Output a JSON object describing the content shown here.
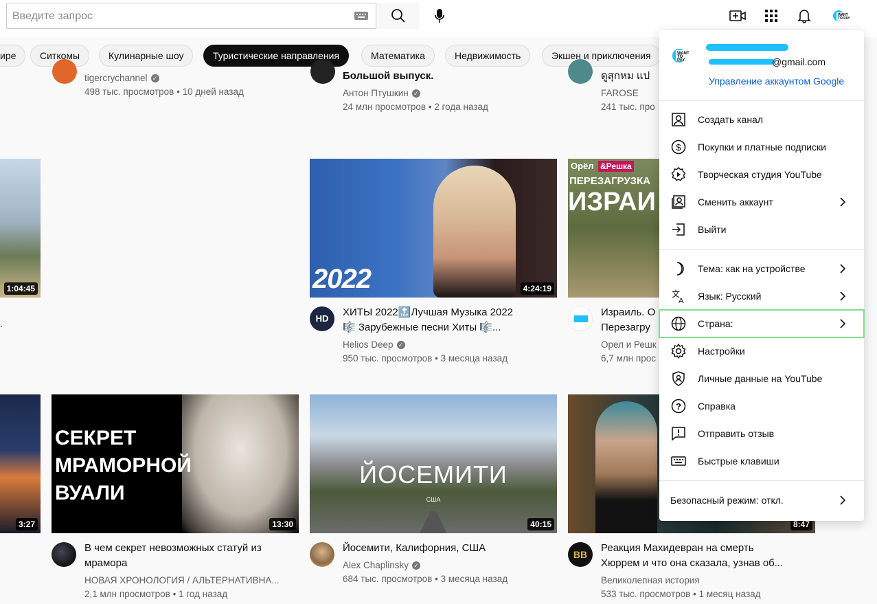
{
  "search": {
    "placeholder": "Введите запрос"
  },
  "chips": [
    "ире",
    "Ситкомы",
    "Кулинарные шоу",
    "Туристические направления",
    "Математика",
    "Недвижимость",
    "Экшен и приключения"
  ],
  "videos_top": [
    {
      "channel": "tigercrychannel",
      "meta": "498 тыс. просмотров • 10 дней назад"
    },
    {
      "title": "Большой выпуск.",
      "channel": "Антон Птушкин",
      "meta": "24 млн просмотров • 2 года назад"
    },
    {
      "title": "ดูสุกหม แป",
      "channel": "FAROSE",
      "meta": "241 тыс. про"
    }
  ],
  "videos_mid": [
    {
      "duration": "1:04:45"
    },
    {
      "duration": "4:24:19",
      "thumb_text": "2022",
      "title_line1": "ХИТЫ 2022🔝Лучшая Музыка 2022",
      "title_line2": "🎼 Зарубежные песни Хиты 🎼...",
      "channel": "Helios Deep",
      "meta": "950 тыс. просмотров • 3 месяца назад",
      "avatar": "HD"
    },
    {
      "thumb_text_1": "Орёл",
      "thumb_text_2": "&Решка",
      "thumb_text_3": "ПЕРЕЗАГРУЗКА",
      "thumb_text_4": "ИЗРАИ",
      "title_line1": "Израиль. О",
      "title_line2": "Перезагру",
      "channel": "Орел и Решк",
      "meta": "6,7 млн прос"
    }
  ],
  "videos_bottom": [
    {
      "duration": "3:27"
    },
    {
      "duration": "13:30",
      "thumb_lines": [
        "СЕКРЕТ",
        "МРАМОРНОЙ",
        "ВУАЛИ"
      ],
      "title_line1": "В чем секрет невозможных статуй из",
      "title_line2": "мрамора",
      "channel": "НОВАЯ ХРОНОЛОГИЯ / АЛЬТЕРНАТИВНА...",
      "meta": "2,1 млн просмотров • 1 год назад"
    },
    {
      "duration": "40:15",
      "thumb_text": "ЙОСЕМИТИ",
      "thumb_sub": "США",
      "title_line1": "Йосемити, Калифорния, США",
      "channel": "Alex Chaplinsky",
      "meta": "684 тыс. просмотров • 3 месяца назад"
    },
    {
      "duration": "8:47",
      "title_line1": "Реакция Махидевран на смерть",
      "title_line2": "Хюррем и что она сказала, узнав об...",
      "channel": "Великолепная история",
      "meta": "533 тыс. просмотров • 1 месяц назад",
      "avatar": "ВВ"
    }
  ],
  "account": {
    "avatar_text": "WANT TO PAY",
    "email_suffix": "@gmail.com",
    "manage_link": "Управление аккаунтом Google"
  },
  "menu": {
    "section1": [
      "Создать канал",
      "Покупки и платные подписки",
      "Творческая студия YouTube",
      "Сменить аккаунт",
      "Выйти"
    ],
    "section2": [
      "Тема: как на устройстве",
      "Язык: Русский",
      "Страна:",
      "Настройки",
      "Личные данные на YouTube",
      "Справка",
      "Отправить отзыв",
      "Быстрые клавиши"
    ],
    "section3": [
      "Безопасный режим: откл."
    ]
  },
  "colors": {
    "accent_link": "#065fd4",
    "highlight": "#7fe08f",
    "redaction": "#1ec0ff"
  }
}
